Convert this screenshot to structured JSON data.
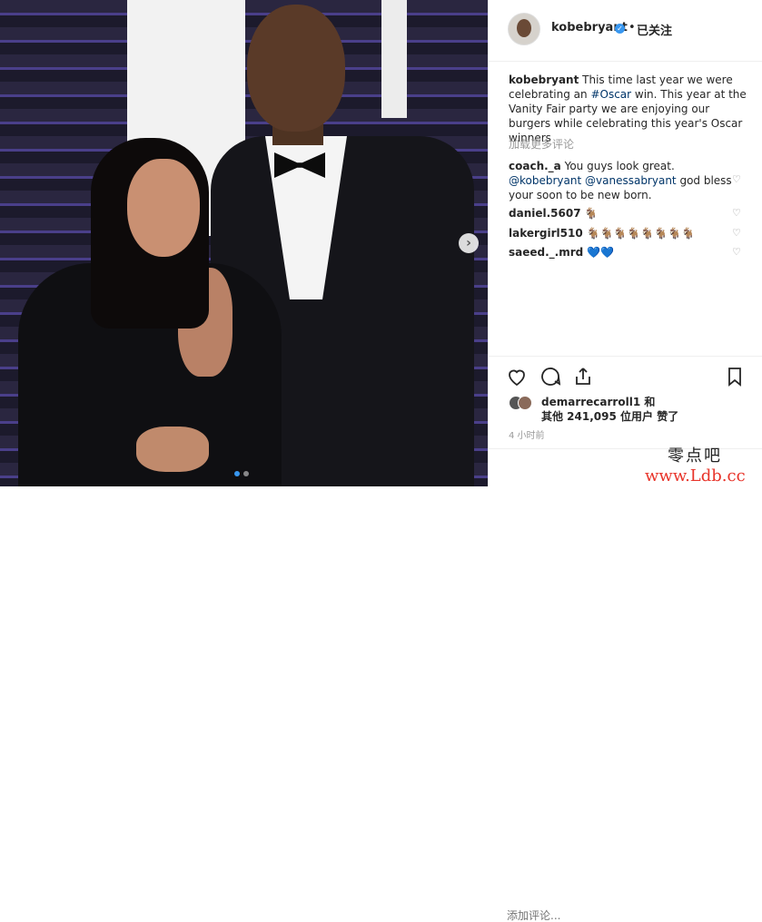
{
  "post": {
    "username": "kobebryant",
    "verified_icon": "verified-badge-icon",
    "separator": "•",
    "follow_status": "已关注",
    "caption_user": "kobebryant",
    "caption_pre": " This time last year we were celebrating an ",
    "caption_hashtag": "#Oscar",
    "caption_post": " win. This year at the Vanity Fair party we are enjoying our burgers while celebrating this year's Oscar winners",
    "load_more": "加载更多评论"
  },
  "comments": [
    {
      "user": "coach._a",
      "pre": " You guys look great. ",
      "mention1": "@kobebryant",
      "mid": " ",
      "mention2": "@vanessabryant",
      "post": " god bless your soon to be new born."
    },
    {
      "user": "daniel.5607",
      "text": " 🐐"
    },
    {
      "user": "lakergirl510",
      "text": " 🐐🐐🐐🐐🐐🐐🐐🐐"
    },
    {
      "user": "saeed._.mrd",
      "text": " 💙💙"
    }
  ],
  "likes": {
    "liker": "demarrecarroll1 和",
    "line2": "其他 241,095 位用户 赞了"
  },
  "timestamp": "4 小时前",
  "comment_placeholder": "添加评论...",
  "watermark": {
    "line1": "零点吧",
    "line2": "www.Ldb.cc"
  },
  "carousel": {
    "current": 1,
    "total": 2
  },
  "colors": {
    "link": "#003569",
    "accent": "#3897f0",
    "muted": "#999999"
  }
}
